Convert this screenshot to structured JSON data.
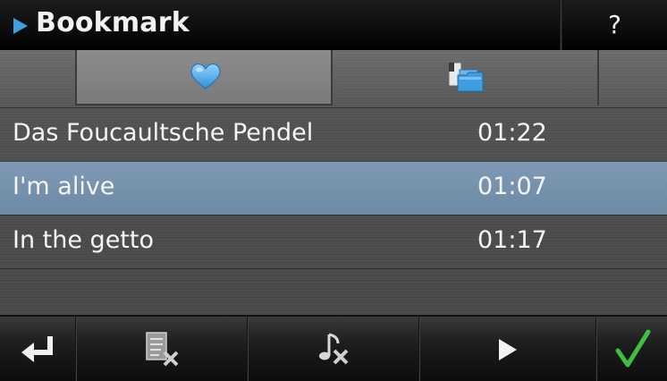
{
  "header": {
    "title": "Bookmark",
    "help_label": "?"
  },
  "tabs": [
    {
      "icon": "heart-icon",
      "active": true
    },
    {
      "icon": "folders-icon",
      "active": false
    }
  ],
  "bookmarks": [
    {
      "name": "Das Foucaultsche Pendel",
      "time": "01:22",
      "selected": false
    },
    {
      "name": "I'm alive",
      "time": "01:07",
      "selected": true
    },
    {
      "name": "In the getto",
      "time": "01:17",
      "selected": false
    }
  ],
  "toolbar": {
    "buttons": [
      {
        "icon": "back-icon"
      },
      {
        "icon": "delete-bookmark-icon"
      },
      {
        "icon": "delete-track-icon"
      },
      {
        "icon": "play-icon"
      },
      {
        "icon": "confirm-check-icon"
      }
    ]
  },
  "colors": {
    "accent_blue": "#4aa8ee",
    "selection": "#7591ad",
    "confirm_green": "#3fbf3f"
  }
}
